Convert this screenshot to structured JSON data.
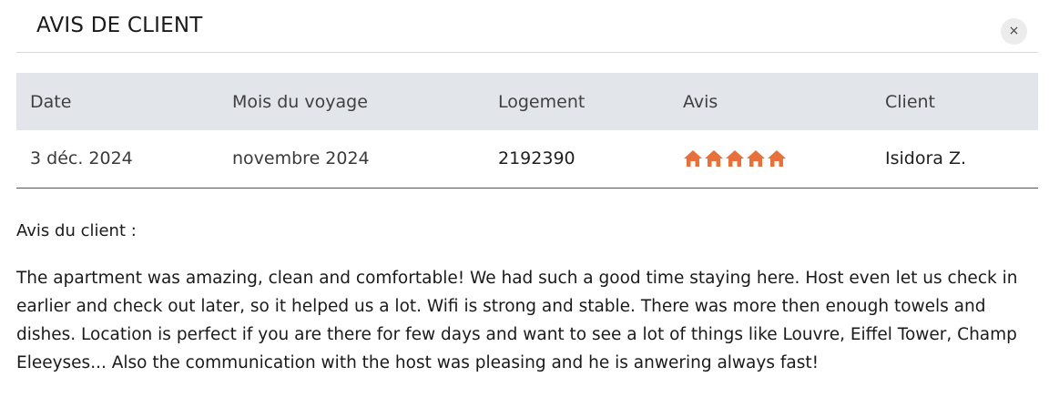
{
  "modal": {
    "title": "AVIS DE CLIENT",
    "close_label": "×"
  },
  "table": {
    "headers": [
      "Date",
      "Mois du voyage",
      "Logement",
      "Avis",
      "Client"
    ],
    "row": {
      "date": "3 déc. 2024",
      "travel_month": "novembre 2024",
      "lodging": "2192390",
      "rating": 5,
      "rating_max": 5,
      "client": "Isidora Z."
    }
  },
  "rating_icon": "house-icon",
  "accent_color": "#e8703a",
  "review": {
    "label": "Avis du client :",
    "text": "The apartment was amazing, clean and comfortable! We had such a good time staying here. Host even let us check in earlier and check out later, so it helped us a lot. Wifi is strong and stable. There was more then enough towels and dishes. Location is perfect if you are there for few days and want to see a lot of things like Louvre, Eiffel Tower, Champ Eleeyses... Also the communication with the host was pleasing and he is anwering always fast!"
  }
}
